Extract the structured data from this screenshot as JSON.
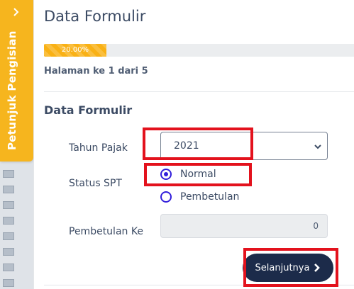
{
  "sidebar_tab": {
    "label": "Petunjuk Pengisian",
    "icon": "chevron-right-icon"
  },
  "page": {
    "title": "Data Formulir"
  },
  "progress": {
    "percent": 20,
    "label": "20.00%",
    "color": "#f9b115"
  },
  "page_info": "Halaman ke 1 dari 5",
  "section": {
    "title": "Data Formulir"
  },
  "form": {
    "tahun_pajak": {
      "label": "Tahun Pajak",
      "value": "2021"
    },
    "status_spt": {
      "label": "Status SPT",
      "options": [
        {
          "label": "Normal",
          "checked": true
        },
        {
          "label": "Pembetulan",
          "checked": false
        }
      ]
    },
    "pembetulan_ke": {
      "label": "Pembetulan Ke",
      "value": "0"
    }
  },
  "buttons": {
    "next_label": "Selanjutnya",
    "next_icon": "chevron-right-icon"
  },
  "colors": {
    "accent": "#321fdb",
    "tab": "#f6b51e",
    "button": "#1c2b4a",
    "highlight": "#e3121d"
  }
}
